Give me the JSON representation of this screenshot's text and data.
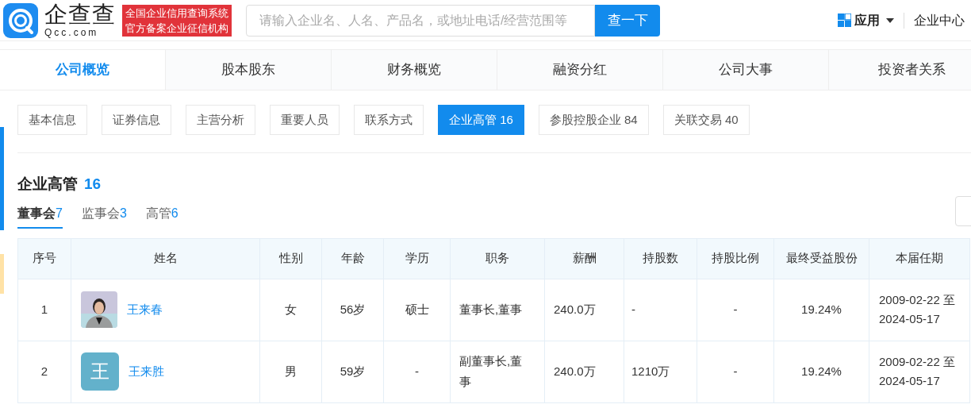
{
  "header": {
    "logo_name": "企查查",
    "logo_domain": "Qcc.com",
    "badge_lines": [
      "全国企业信用查询系统",
      "官方备案企业征信机构"
    ],
    "search": {
      "placeholder": "请输入企业名、人名、产品名，或地址电话/经营范围等"
    },
    "search_button": "查一下",
    "apps": "应用",
    "enterprise_center": "企业中心"
  },
  "main_tabs": [
    {
      "label": "公司概览",
      "selected": true
    },
    {
      "label": "股本股东",
      "selected": false
    },
    {
      "label": "财务概览",
      "selected": false
    },
    {
      "label": "融资分红",
      "selected": false
    },
    {
      "label": "公司大事",
      "selected": false
    },
    {
      "label": "投资者关系",
      "selected": false
    }
  ],
  "sub_tabs": [
    {
      "label": "基本信息",
      "selected": false
    },
    {
      "label": "证券信息",
      "selected": false
    },
    {
      "label": "主营分析",
      "selected": false
    },
    {
      "label": "重要人员",
      "selected": false
    },
    {
      "label": "联系方式",
      "selected": false
    },
    {
      "label": "企业高管 16",
      "selected": true
    },
    {
      "label": "参股控股企业 84",
      "selected": false
    },
    {
      "label": "关联交易 40",
      "selected": false
    }
  ],
  "section": {
    "title": "企业高管",
    "count": "16"
  },
  "group_tabs": [
    {
      "label": "董事会",
      "count": "7",
      "selected": true
    },
    {
      "label": "监事会",
      "count": "3",
      "selected": false
    },
    {
      "label": "高管",
      "count": "6",
      "selected": false
    }
  ],
  "table": {
    "columns": [
      "序号",
      "姓名",
      "性别",
      "年龄",
      "学历",
      "职务",
      "薪酬",
      "持股数",
      "持股比例",
      "最终受益股份",
      "本届任期"
    ],
    "rows": [
      {
        "index": "1",
        "avatar": {
          "kind": "picture"
        },
        "name": "王来春",
        "gender": "女",
        "age": "56岁",
        "education": "硕士",
        "position": "董事长,董事",
        "salary": "240.0万",
        "shares": "-",
        "ratio": "-",
        "beneficial": "19.24%",
        "term": [
          "2009-02-22 至",
          "2024-05-17"
        ]
      },
      {
        "index": "2",
        "avatar": {
          "kind": "letter",
          "text": "王"
        },
        "name": "王来胜",
        "gender": "男",
        "age": "59岁",
        "education": "-",
        "position": "副董事长,董事",
        "salary": "240.0万",
        "shares": "1210万",
        "ratio": "-",
        "beneficial": "19.24%",
        "term": [
          "2009-02-22 至",
          "2024-05-17"
        ]
      }
    ]
  }
}
